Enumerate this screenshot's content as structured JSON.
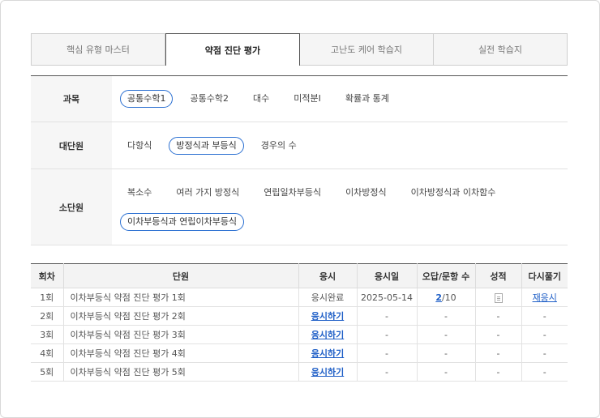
{
  "tabs": [
    {
      "label": "핵심 유형 마스터",
      "active": false
    },
    {
      "label": "약점 진단 평가",
      "active": true
    },
    {
      "label": "고난도 케어 학습지",
      "active": false
    },
    {
      "label": "실전 학습지",
      "active": false
    }
  ],
  "filters": {
    "subject": {
      "label": "과목",
      "options": [
        "공통수학1",
        "공통수학2",
        "대수",
        "미적분Ⅰ",
        "확률과 통계"
      ],
      "selected": "공통수학1"
    },
    "major_unit": {
      "label": "대단원",
      "options": [
        "다항식",
        "방정식과 부등식",
        "경우의 수"
      ],
      "selected": "방정식과 부등식"
    },
    "minor_unit": {
      "label": "소단원",
      "options": [
        "복소수",
        "여러 가지 방정식",
        "연립일차부등식",
        "이차방정식",
        "이차방정식과 이차함수",
        "이차부등식과 연립이차부등식"
      ],
      "selected": "이차부등식과 연립이차부등식"
    }
  },
  "table": {
    "headers": [
      "회차",
      "단원",
      "응시",
      "응시일",
      "오답/문항 수",
      "성적",
      "다시풀기"
    ],
    "rows": [
      {
        "round": "1회",
        "unit": "이차부등식 약점 진단 평가 1회",
        "status": "응시완료",
        "date": "2025-05-14",
        "wrong": "2",
        "total": "/10",
        "retry": "재응시"
      },
      {
        "round": "2회",
        "unit": "이차부등식 약점 진단 평가 2회",
        "status": "응시하기",
        "date": "-",
        "wrong": "-",
        "total": "",
        "retry": "-"
      },
      {
        "round": "3회",
        "unit": "이차부등식 약점 진단 평가 3회",
        "status": "응시하기",
        "date": "-",
        "wrong": "-",
        "total": "",
        "retry": "-"
      },
      {
        "round": "4회",
        "unit": "이차부등식 약점 진단 평가 4회",
        "status": "응시하기",
        "date": "-",
        "wrong": "-",
        "total": "",
        "retry": "-"
      },
      {
        "round": "5회",
        "unit": "이차부등식 약점 진단 평가 5회",
        "status": "응시하기",
        "date": "-",
        "wrong": "-",
        "total": "",
        "retry": "-"
      }
    ],
    "score_dash": "-"
  }
}
